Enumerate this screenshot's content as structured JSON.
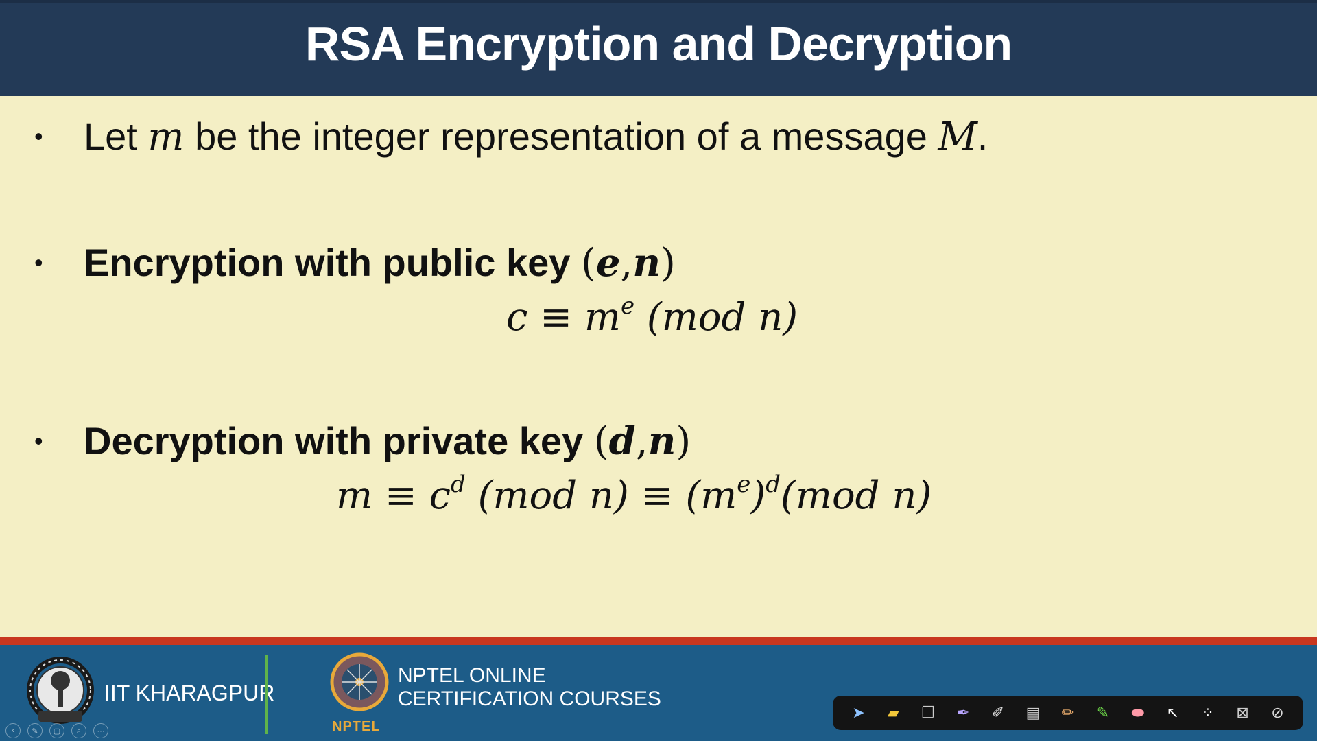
{
  "slide": {
    "title": "RSA Encryption and Decryption",
    "bullets": [
      {
        "symbol": "•",
        "text_a": "Let ",
        "var_m": "m",
        "text_b": " be the integer representation of a message ",
        "var_M": "M",
        "text_c": "."
      },
      {
        "symbol": "•",
        "text": "Encryption with public key ",
        "key_open": "(",
        "key_var1": "e",
        "key_sep": ",",
        "key_var2": "n",
        "key_close": ")"
      },
      {
        "symbol": "•",
        "text": "Decryption with private key ",
        "key_open": "(",
        "key_var1": "d",
        "key_sep": ",",
        "key_var2": "n",
        "key_close": ")"
      }
    ],
    "formula_encrypt": {
      "lhs": "c ≡ m",
      "exp": "e",
      "rhs": " (mod n)"
    },
    "formula_decrypt": {
      "part1": "m ≡ c",
      "exp1": "d",
      "part2": " (mod n) ≡ (m",
      "exp2": "e",
      "part3": ")",
      "exp3": "d",
      "part4": "(mod n)"
    }
  },
  "footer": {
    "institute": "IIT KHARAGPUR",
    "nptel_line1": "NPTEL ONLINE",
    "nptel_line2": "CERTIFICATION COURSES",
    "nptel_small": "NPTEL"
  },
  "toolbar": {
    "tools": [
      "arrow-icon",
      "folder-icon",
      "pages-icon",
      "pen-icon",
      "highlighter-icon",
      "screen-icon",
      "pencil-icon",
      "marker-icon",
      "eraser-icon",
      "pointer-icon",
      "laser-icon",
      "clear-icon",
      "stop-icon"
    ]
  },
  "colors": {
    "title_bg": "#233a57",
    "slide_bg": "#f4efc5",
    "footer_bg": "#1d5c88",
    "footer_strip": "#c8371f",
    "divider": "#5fb34a"
  }
}
